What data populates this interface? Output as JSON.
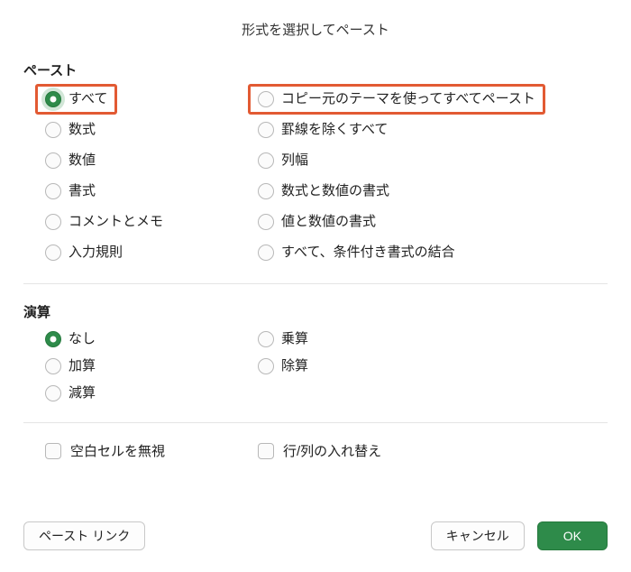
{
  "title": "形式を選択してペースト",
  "paste": {
    "label": "ペースト",
    "left": [
      {
        "id": "all",
        "label": "すべて",
        "selected": true,
        "highlight": true
      },
      {
        "id": "formulas",
        "label": "数式"
      },
      {
        "id": "values",
        "label": "数値"
      },
      {
        "id": "formats",
        "label": "書式"
      },
      {
        "id": "comments",
        "label": "コメントとメモ"
      },
      {
        "id": "validation",
        "label": "入力規則"
      }
    ],
    "right": [
      {
        "id": "theme",
        "label": "コピー元のテーマを使ってすべてペースト",
        "highlight": true
      },
      {
        "id": "noborder",
        "label": "罫線を除くすべて"
      },
      {
        "id": "colwidth",
        "label": "列幅"
      },
      {
        "id": "formulanumfmt",
        "label": "数式と数値の書式"
      },
      {
        "id": "valuenumfmt",
        "label": "値と数値の書式"
      },
      {
        "id": "mergecond",
        "label": "すべて、条件付き書式の結合"
      }
    ]
  },
  "operation": {
    "label": "演算",
    "left": [
      {
        "id": "none",
        "label": "なし",
        "selected": true
      },
      {
        "id": "add",
        "label": "加算"
      },
      {
        "id": "sub",
        "label": "減算"
      }
    ],
    "right": [
      {
        "id": "mul",
        "label": "乗算"
      },
      {
        "id": "div",
        "label": "除算"
      }
    ]
  },
  "checkboxes": {
    "skipBlanks": "空白セルを無視",
    "transpose": "行/列の入れ替え"
  },
  "buttons": {
    "pasteLink": "ペースト リンク",
    "cancel": "キャンセル",
    "ok": "OK"
  }
}
